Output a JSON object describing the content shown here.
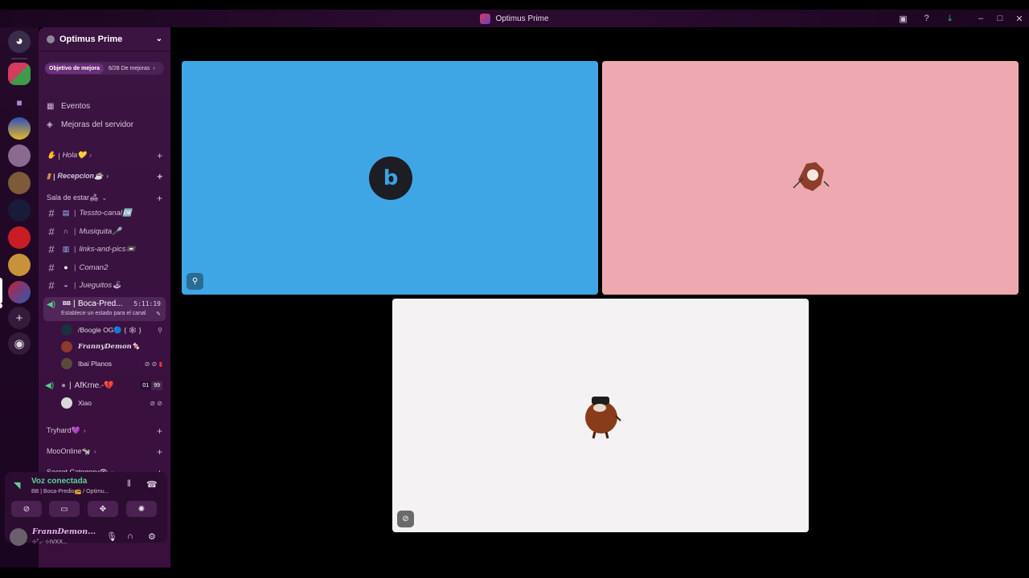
{
  "window": {
    "title": "Optimus Prime"
  },
  "server": {
    "name": "Optimus Prime",
    "boost_label": "Objetivo de mejora",
    "boost_count": "6/28 De mejoras",
    "nav": [
      {
        "label": "Eventos"
      },
      {
        "label": "Mejoras del servidor"
      }
    ]
  },
  "categories": {
    "hola": "Hola💛",
    "recepcion": "Recepcion☕",
    "sala": "Sala de estar🛋",
    "tryhard": "Tryhard💜",
    "moo": "MooOnline🐄",
    "secret": "Secret Category👁"
  },
  "channels": [
    {
      "name": "Tessto-canal🆗"
    },
    {
      "name": "Musiquita🎤"
    },
    {
      "name": "links-and-pics📼"
    },
    {
      "name": "Coman2"
    },
    {
      "name": "Jueguitos🕹"
    }
  ],
  "voice_channel": {
    "prefix": "BB",
    "name": "Boca-Pred...",
    "time": "5:11:19",
    "status": "Establece un estado para el canal",
    "users": [
      {
        "name": "/Boogle OG🔵 { 🕸 }"
      },
      {
        "name": "FrannyDemon🍬"
      },
      {
        "name": "Ibai Planos"
      }
    ]
  },
  "voice_channel_2": {
    "name": "AfKrne.-💔",
    "limit_a": "01",
    "limit_b": "99",
    "users": [
      {
        "name": "Xiao"
      }
    ]
  },
  "voice_panel": {
    "status": "Voz conectada",
    "channel": "BB | Boca-Predio📻 / Optimu..."
  },
  "user_panel": {
    "name": "FrannDemon...",
    "status": "⊹˚₊‧ ⊹IVXX..."
  },
  "stage_tiles": [
    {
      "color": "#3fa6e6",
      "label": ""
    },
    {
      "color": "#eea8af",
      "label": ""
    },
    {
      "color": "#f4f2f3",
      "label": ""
    }
  ],
  "icons": {
    "discord_home": "discord-icon",
    "add_server": "plus-icon",
    "discover": "compass-icon"
  }
}
